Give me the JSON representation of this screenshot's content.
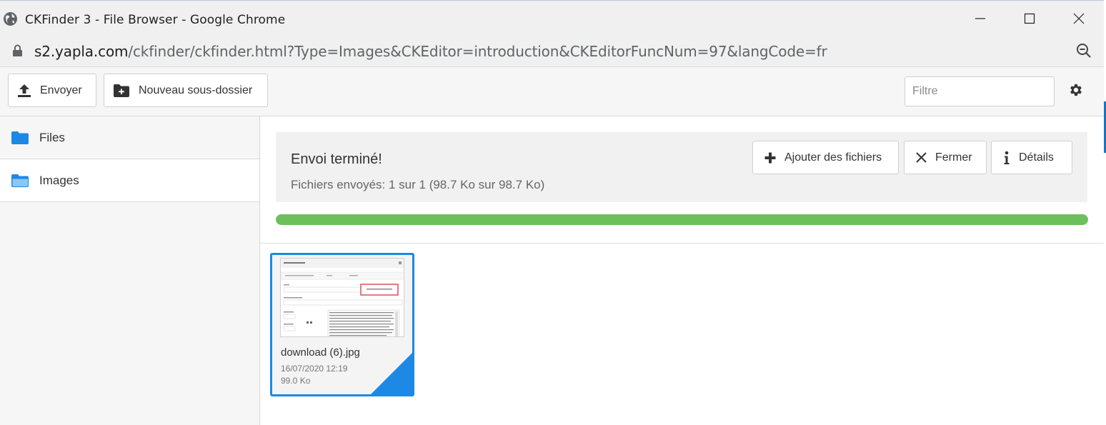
{
  "window": {
    "title": "CKFinder 3 - File Browser - Google Chrome"
  },
  "address_bar": {
    "host": "s2.yapla.com",
    "path": "/ckfinder/ckfinder.html?Type=Images&CKEditor=introduction&CKEditorFuncNum=97&langCode=fr"
  },
  "toolbar": {
    "upload_label": "Envoyer",
    "new_folder_label": "Nouveau sous-dossier",
    "filter_placeholder": "Filtre"
  },
  "sidebar": {
    "items": [
      {
        "label": "Files",
        "selected": false
      },
      {
        "label": "Images",
        "selected": true
      }
    ]
  },
  "upload_panel": {
    "status": "Envoi terminé!",
    "progress_text": "Fichiers envoyés: 1 sur 1 (98.7 Ko sur 98.7 Ko)",
    "add_files_label": "Ajouter des fichiers",
    "close_label": "Fermer",
    "details_label": "Détails",
    "progress_percent": 100
  },
  "files": [
    {
      "name": "download (6).jpg",
      "date": "16/07/2020 12:19",
      "size": "99.0 Ko",
      "selected": true
    }
  ],
  "colors": {
    "accent": "#1e88e5",
    "progress": "#6dbf5b",
    "folder": "#1e88e5"
  }
}
